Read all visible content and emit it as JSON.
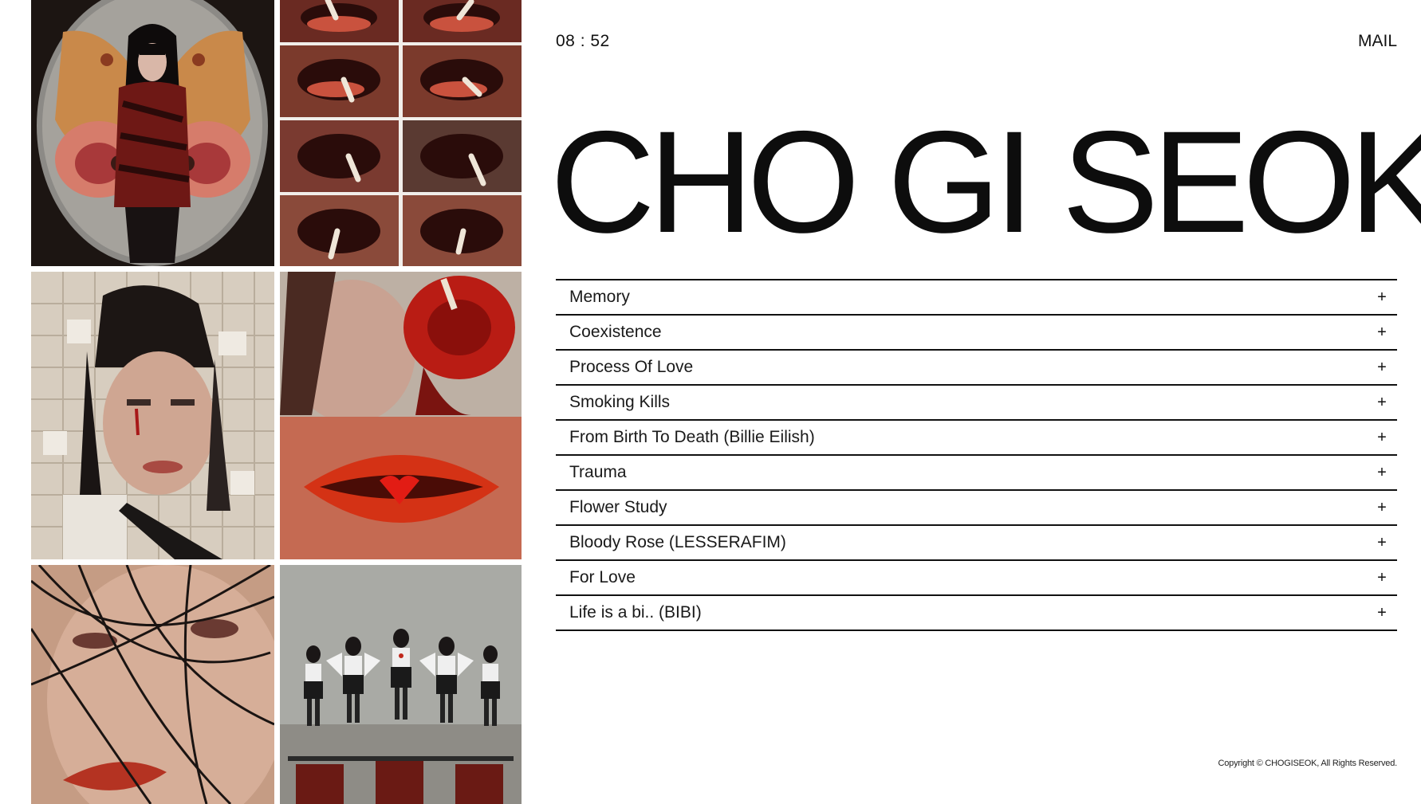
{
  "header": {
    "clock": "08 : 52",
    "mail_label": "MAIL"
  },
  "hero": {
    "title": "CHO GI SEOK"
  },
  "menu": {
    "items": [
      {
        "label": "Memory",
        "toggle": "+"
      },
      {
        "label": "Coexistence",
        "toggle": "+"
      },
      {
        "label": "Process Of Love",
        "toggle": "+"
      },
      {
        "label": "Smoking Kills",
        "toggle": "+"
      },
      {
        "label": "From Birth To Death (Billie Eilish)",
        "toggle": "+"
      },
      {
        "label": "Trauma",
        "toggle": "+"
      },
      {
        "label": "Flower Study",
        "toggle": "+"
      },
      {
        "label": "Bloody Rose (LESSERAFIM)",
        "toggle": "+"
      },
      {
        "label": "For Love",
        "toggle": "+"
      },
      {
        "label": "Life is a bi.. (BIBI)",
        "toggle": "+"
      }
    ]
  },
  "gallery": {
    "images": [
      {
        "name": "portrait-moth-oval-photo"
      },
      {
        "name": "smoking-lips-grid-photo"
      },
      {
        "name": "puzzle-face-photo"
      },
      {
        "name": "rose-red-lips-photo"
      },
      {
        "name": "hair-face-closeup-photo"
      },
      {
        "name": "angel-wings-group-photo"
      }
    ]
  },
  "footer": {
    "copyright": "Copyright © CHOGISEOK, All Rights Reserved."
  },
  "colors": {
    "background": "#ffffff",
    "text": "#111111",
    "rule": "#111111",
    "accent_red": "#c0281c"
  }
}
